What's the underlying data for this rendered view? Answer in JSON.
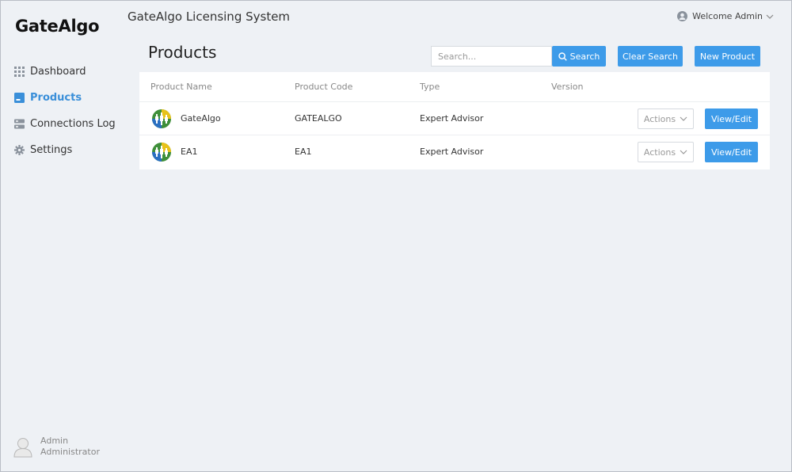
{
  "sidebar": {
    "logo": "GateAlgo",
    "items": [
      {
        "label": "Dashboard",
        "icon": "grid-icon",
        "active": false
      },
      {
        "label": "Products",
        "icon": "product-icon",
        "active": true
      },
      {
        "label": "Connections Log",
        "icon": "server-icon",
        "active": false
      },
      {
        "label": "Settings",
        "icon": "gear-icon",
        "active": false
      }
    ],
    "user": {
      "name": "Admin",
      "role": "Administrator"
    }
  },
  "header": {
    "app_title": "GateAlgo Licensing System",
    "welcome": "Welcome Admin"
  },
  "page": {
    "title": "Products"
  },
  "toolbar": {
    "search_placeholder": "Search...",
    "search_value": "",
    "search_label": "Search",
    "clear_label": "Clear Search",
    "new_label": "New Product"
  },
  "table": {
    "columns": [
      "Product Name",
      "Product Code",
      "Type",
      "Version"
    ],
    "rows": [
      {
        "name": "GateAlgo",
        "code": "GATEALGO",
        "type": "Expert Advisor",
        "version": "",
        "actions_label": "Actions",
        "view_label": "View/Edit"
      },
      {
        "name": "EA1",
        "code": "EA1",
        "type": "Expert Advisor",
        "version": "",
        "actions_label": "Actions",
        "view_label": "View/Edit"
      }
    ]
  },
  "colors": {
    "accent": "#3d9be9",
    "active_nav": "#3a8fd9",
    "background": "#eef1f5"
  }
}
